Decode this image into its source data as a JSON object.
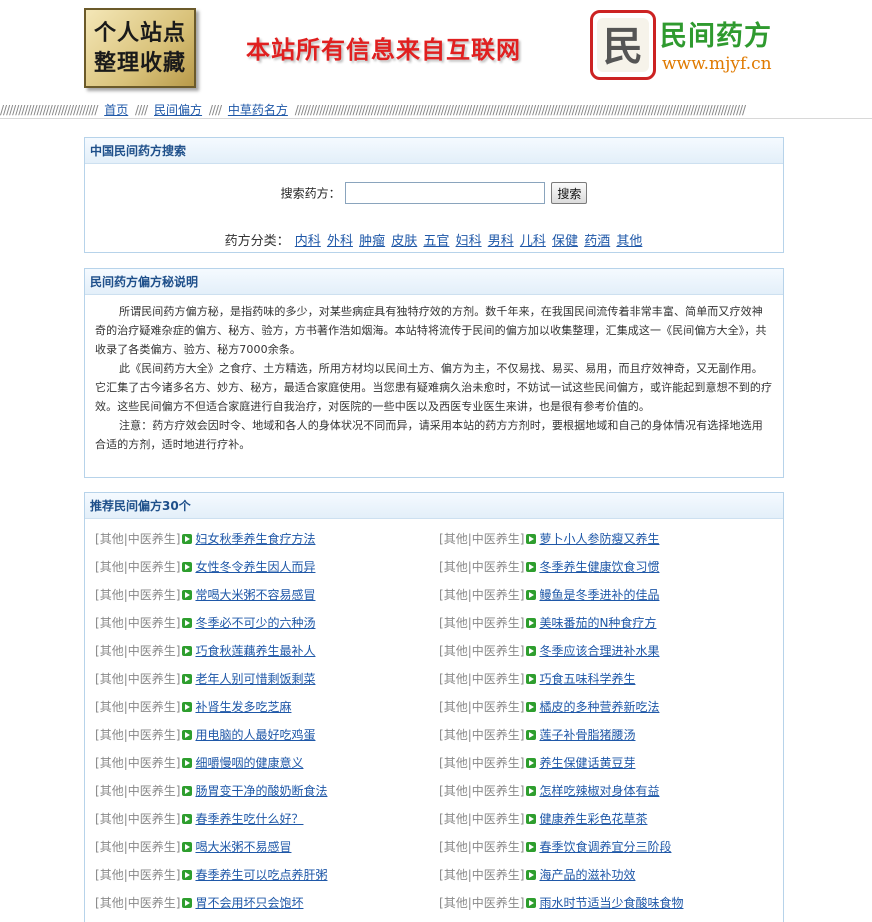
{
  "header": {
    "logo_left_line1": "个人站点",
    "logo_left_line2": "整理收藏",
    "slogan": "本站所有信息来自互联网",
    "logo_right_char": "民",
    "site_name": "民间药方",
    "site_url": "www.mjyf.cn"
  },
  "breadcrumb": {
    "sep_left": "////////////////////////////////",
    "items": [
      "首页",
      "民间偏方",
      "中草药名方"
    ],
    "sep_mid": "////",
    "sep_right": "////////////////////////////////////////////////////////////////////////////////////////////////////////////////////////////////////////////////////"
  },
  "search": {
    "title": "中国民间药方搜索",
    "label": "搜索药方：",
    "input_value": "",
    "button_label": "搜索",
    "category_label": "药方分类：",
    "categories": [
      "内科",
      "外科",
      "肿瘤",
      "皮肤",
      "五官",
      "妇科",
      "男科",
      "儿科",
      "保健",
      "药酒",
      "其他"
    ]
  },
  "intro": {
    "title": "民间药方偏方秘说明",
    "paragraphs": [
      "所谓民间药方偏方秘，是指药味的多少，对某些病症具有独特疗效的方剂。数千年来，在我国民间流传着非常丰富、简单而又疗效神奇的治疗疑难杂症的偏方、秘方、验方，方书著作浩如烟海。本站特将流传于民间的偏方加以收集整理，汇集成这一《民间偏方大全》，共收录了各类偏方、验方、秘方7000余条。",
      "此《民间药方大全》之食疗、土方精选，所用方材均以民间土方、偏方为主，不仅易找、易买、易用，而且疗效神奇，又无副作用。它汇集了古今诸多名方、妙方、秘方，最适合家庭使用。当您患有疑难病久治未愈时，不妨试一试这些民间偏方，或许能起到意想不到的疗效。这些民间偏方不但适合家庭进行自我治疗，对医院的一些中医以及西医专业医生来讲，也是很有参考价值的。",
      "注意：药方疗效会因时令、地域和各人的身体状况不同而异，请采用本站的药方方剂时，要根据地域和自己的身体情况有选择地选用合适的方剂，适时地进行疗补。"
    ]
  },
  "recommend": {
    "title": "推荐民间偏方30个",
    "tag1": "其他",
    "tag2": "中医养生",
    "items": [
      "妇女秋季养生食疗方法",
      "萝卜小人参防瘦又养生",
      "女性冬令养生因人而异",
      "冬季养生健康饮食习惯",
      "常喝大米粥不容易感冒",
      "鳗鱼是冬季进补的佳品",
      "冬季必不可少的六种汤",
      "美味番茄的N种食疗方",
      "巧食秋莲藕养生最补人",
      "冬季应该合理进补水果",
      "老年人别可惜剩饭剩菜",
      "巧食五味科学养生",
      "补肾生发多吃芝麻",
      "橘皮的多种营养新吃法",
      "用电脑的人最好吃鸡蛋",
      "莲子补骨脂猪腰汤",
      "细嚼慢咽的健康意义",
      "养生保健话黄豆芽",
      "肠胃变干净的酸奶断食法",
      "怎样吃辣椒对身体有益",
      "春季养生吃什么好？",
      "健康养生彩色花草茶",
      "喝大米粥不易感冒",
      "春季饮食调养宜分三阶段",
      "春季养生可以吃点养肝粥",
      "海产品的滋补功效",
      "胃不会用坏只会饱坏",
      "雨水时节适当少食酸味食物"
    ]
  }
}
